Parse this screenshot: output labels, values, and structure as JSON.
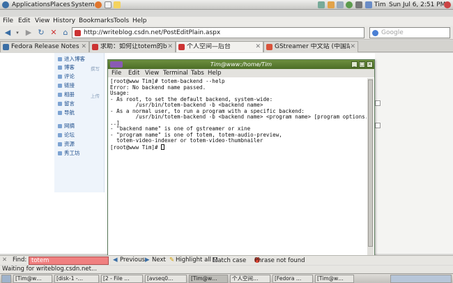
{
  "gnome_panel": {
    "applications": "Applications",
    "places": "Places",
    "system": "System",
    "user": "Tim",
    "clock": "Sun Jul  6,  2:51 PM"
  },
  "firefox": {
    "menu": [
      "File",
      "Edit",
      "View",
      "History",
      "Bookmarks",
      "Tools",
      "Help"
    ],
    "url": "http://writeblog.csdn.net/PostEditPlain.aspx",
    "search_placeholder": "Google",
    "tabs": [
      {
        "label": "Fedora Release Notes",
        "active": false
      },
      {
        "label": "求助：如何让totem的bac…",
        "active": false
      },
      {
        "label": "个人空间—后台",
        "active": true
      },
      {
        "label": "GStreamer 中文站 (中国站)",
        "active": false
      }
    ]
  },
  "page": {
    "sidebar": {
      "items": [
        "进入博客",
        "博客",
        "评论",
        "链接",
        "相册",
        "留言",
        "导航",
        "网摘",
        "论坛",
        "资源",
        "秀工坊"
      ],
      "hints": [
        "撰写",
        "上传"
      ]
    }
  },
  "terminal": {
    "title": "Tim@www:/home/Tim",
    "menu": [
      "File",
      "Edit",
      "View",
      "Terminal",
      "Tabs",
      "Help"
    ],
    "lines": [
      "[root@www Tim]# totem-backend --help",
      "Error: No backend name passed.",
      "Usage:",
      "- As root, to set the default backend, system-wide:",
      "        /usr/bin/totem-backend -b <backend name>",
      "",
      "- As a normal user, to run a program with a specific backend:",
      "        /usr/bin/totem-backend -b <backend name> <program name> [program options.",
      "..]",
      "",
      "- \"backend name\" is one of gstreamer or xine",
      "- \"program name\" is one of totem, totem-audio-preview,",
      "  totem-video-indexer or totem-video-thumbnailer",
      "",
      "[root@www Tim]# "
    ]
  },
  "findbar": {
    "label": "Find:",
    "value": "totem",
    "previous": "Previous",
    "next": "Next",
    "highlight": "Highlight all",
    "match_case": "Match case",
    "result": "Phrase not found"
  },
  "statusbar": {
    "text": "Waiting for writeblog.csdn.net..."
  },
  "taskbar": {
    "items": [
      "[Tim@w…",
      "[disk-1 -…",
      "[2 - File …",
      "[avseq0…",
      "[Tim@w…",
      "个人空间…",
      "[Fedora …",
      "[Tim@w…"
    ]
  },
  "colors": {
    "find_not_found": "#f08080",
    "terminal_title": "#5a7d32"
  }
}
